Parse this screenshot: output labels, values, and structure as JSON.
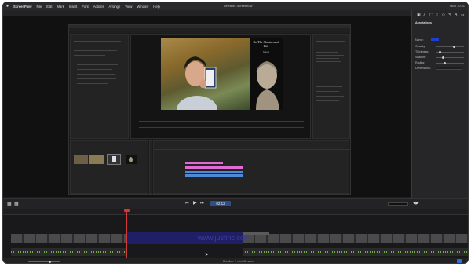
{
  "menubar": {
    "apple": "",
    "app": "ScreenFlow",
    "items": [
      "File",
      "Edit",
      "Mark",
      "Insert",
      "Font",
      "Actions",
      "Arrange",
      "View",
      "Window",
      "Help"
    ],
    "document_title": "Timeline1.screenflow",
    "status": "Mon 10:41"
  },
  "inspector": {
    "title": "Annotations",
    "name_label": "Name:",
    "opacity_label": "Opacity:",
    "thickness_label": "Thickness:",
    "shadow_label": "Shadow:",
    "radius_label": "Radius:",
    "dimension_label": "Dimensions:"
  },
  "premiere": {
    "book_title": "On The Shortness of Life",
    "book_author": "Seneca",
    "small_book_text": "ON THE SHORTNESS OF LIFE"
  },
  "transport": {
    "timecode": "02:12"
  },
  "timeline": {
    "overlay_text": "www.justinc.com",
    "duration": "Duration: 7 mins 58 secs"
  },
  "colors": {
    "playhead": "#d23a3a",
    "media_clip": "#1f1f66",
    "audio_wave": "#6fb04a",
    "tl_pink": "#e26ad7",
    "tl_blue": "#4f8ad6"
  }
}
